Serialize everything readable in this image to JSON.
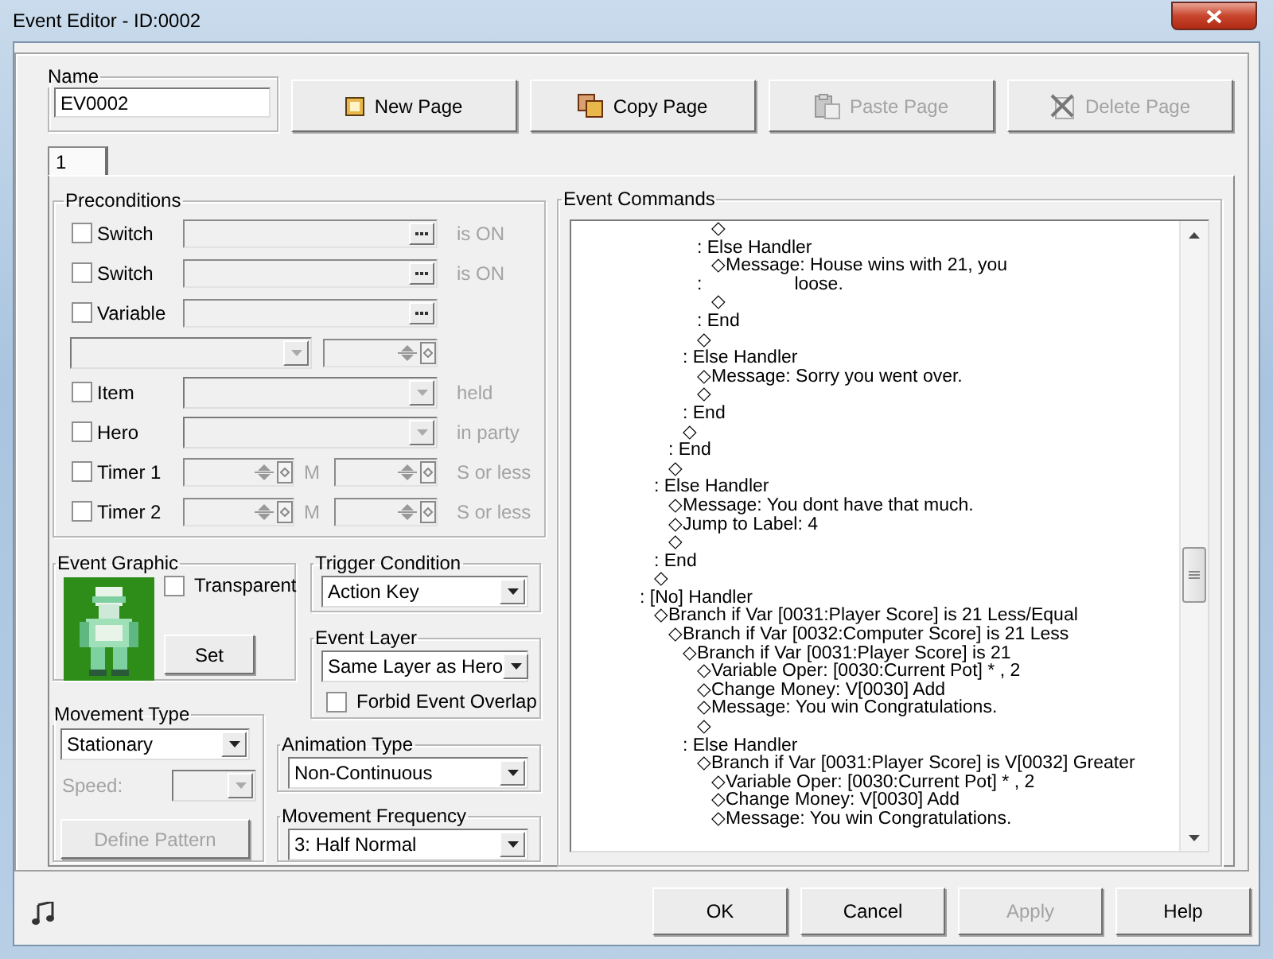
{
  "window": {
    "title": "Event Editor - ID:0002"
  },
  "name": {
    "label": "Name",
    "value": "EV0002"
  },
  "page_buttons": [
    {
      "label": "New Page",
      "kind": "new",
      "disabled": false
    },
    {
      "label": "Copy Page",
      "kind": "copy",
      "disabled": false
    },
    {
      "label": "Paste Page",
      "kind": "paste",
      "disabled": true
    },
    {
      "label": "Delete Page",
      "kind": "delete",
      "disabled": true
    }
  ],
  "tabs": [
    {
      "label": "1",
      "selected": true
    }
  ],
  "preconditions": {
    "title": "Preconditions",
    "rows": [
      {
        "kind": "picker",
        "label": "Switch",
        "checked": false,
        "suffix": "is ON"
      },
      {
        "kind": "picker",
        "label": "Switch",
        "checked": false,
        "suffix": "is ON"
      },
      {
        "kind": "picker",
        "label": "Variable",
        "checked": false
      },
      {
        "kind": "compare",
        "disabled": true
      },
      {
        "kind": "dropdown",
        "label": "Item",
        "checked": false,
        "suffix": "held"
      },
      {
        "kind": "dropdown",
        "label": "Hero",
        "checked": false,
        "suffix": "in party"
      },
      {
        "kind": "timer",
        "label": "Timer 1",
        "checked": false,
        "unit": "M",
        "suffix": "S or less"
      },
      {
        "kind": "timer",
        "label": "Timer 2",
        "checked": false,
        "unit": "M",
        "suffix": "S or less"
      }
    ]
  },
  "event_graphic": {
    "title": "Event Graphic",
    "transparent": {
      "label": "Transparent",
      "checked": false
    },
    "set_button": "Set"
  },
  "trigger_condition": {
    "title": "Trigger Condition",
    "value": "Action Key"
  },
  "event_layer": {
    "title": "Event Layer",
    "value": "Same Layer as Hero",
    "forbid_overlap": {
      "label": "Forbid Event Overlap",
      "checked": false
    }
  },
  "movement_type": {
    "title": "Movement Type",
    "value": "Stationary",
    "speed_label": "Speed:",
    "speed_disabled": true,
    "define_pattern": {
      "label": "Define Pattern",
      "disabled": true
    }
  },
  "animation_type": {
    "title": "Animation Type",
    "value": "Non-Continuous"
  },
  "movement_frequency": {
    "title": "Movement Frequency",
    "value": "3: Half Normal"
  },
  "event_commands": {
    "title": "Event Commands",
    "lines": [
      {
        "children": [
          {
            "children": [
              {
                "children": [
                  {
                    "children": [
                      {
                        "children": [
                          {
                            "text": "◇"
                          }
                        ]
                      },
                      {
                        "text": ": Else Handler",
                        "children": [
                          {
                            "text": "◇Message: House wins with 21, you"
                          },
                          {
                            "kind": "continuation",
                            "marker": ":",
                            "text": "loose."
                          },
                          {
                            "text": "◇"
                          }
                        ]
                      },
                      {
                        "text": ": End"
                      },
                      {
                        "text": "◇"
                      }
                    ]
                  },
                  {
                    "text": ": Else Handler",
                    "children": [
                      {
                        "text": "◇Message: Sorry you went over."
                      },
                      {
                        "text": "◇"
                      }
                    ]
                  },
                  {
                    "text": ": End"
                  },
                  {
                    "text": "◇"
                  }
                ]
              },
              {
                "text": ": End"
              },
              {
                "text": "◇"
              }
            ]
          },
          {
            "text": ": Else Handler",
            "children": [
              {
                "text": "◇Message: You dont have that much."
              },
              {
                "text": "◇Jump to Label: 4"
              },
              {
                "text": "◇"
              }
            ]
          },
          {
            "text": ": End"
          },
          {
            "text": "◇"
          }
        ]
      },
      {
        "text": ": [No] Handler",
        "children": [
          {
            "text": "◇Branch if Var [0031:Player Score] is 21 Less/Equal",
            "children": [
              {
                "text": "◇Branch if Var [0032:Computer Score] is 21 Less",
                "children": [
                  {
                    "text": "◇Branch if Var [0031:Player Score] is 21",
                    "children": [
                      {
                        "text": "◇Variable Oper: [0030:Current Pot] * , 2"
                      },
                      {
                        "text": "◇Change Money: V[0030] Add"
                      },
                      {
                        "text": "◇Message: You win Congratulations."
                      },
                      {
                        "text": "◇"
                      }
                    ]
                  },
                  {
                    "text": ": Else Handler",
                    "children": [
                      {
                        "text": "◇Branch if Var [0031:Player Score] is V[0032] Greater",
                        "children": [
                          {
                            "text": "◇Variable Oper: [0030:Current Pot] * , 2"
                          },
                          {
                            "text": "◇Change Money: V[0030] Add"
                          },
                          {
                            "text": "◇Message: You win Congratulations."
                          }
                        ]
                      }
                    ]
                  }
                ]
              }
            ]
          }
        ]
      }
    ]
  },
  "buttons": [
    {
      "label": "OK",
      "disabled": false
    },
    {
      "label": "Cancel",
      "disabled": false
    },
    {
      "label": "Apply",
      "disabled": true
    },
    {
      "label": "Help",
      "disabled": false
    }
  ]
}
